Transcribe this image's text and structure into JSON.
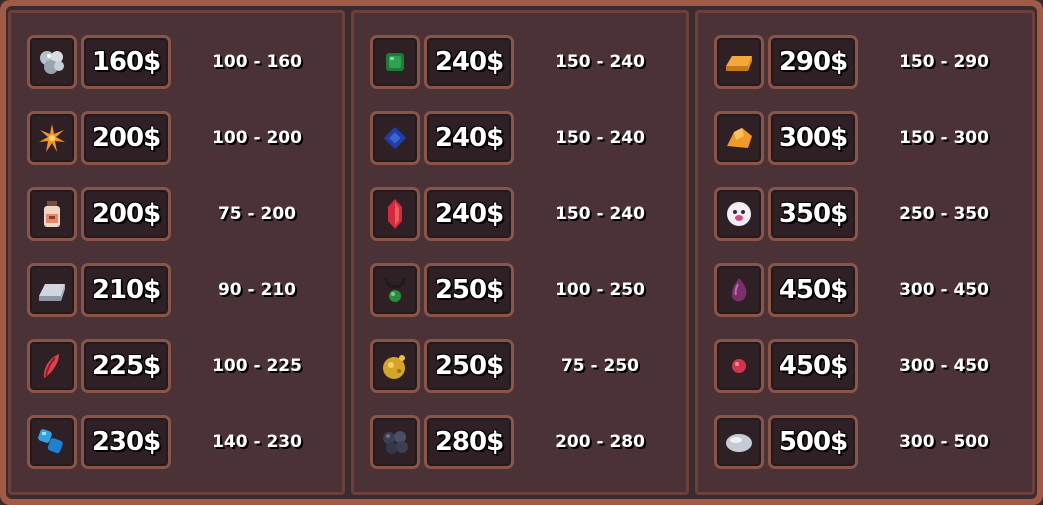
{
  "columns": [
    {
      "items": [
        {
          "icon": "silver-ore-icon",
          "price": "160$",
          "range": "100 - 160"
        },
        {
          "icon": "spark-icon",
          "price": "200$",
          "range": "100 - 200"
        },
        {
          "icon": "potion-jar-icon",
          "price": "200$",
          "range": "75 - 200"
        },
        {
          "icon": "iron-ingot-icon",
          "price": "210$",
          "range": "90 - 210"
        },
        {
          "icon": "red-feather-icon",
          "price": "225$",
          "range": "100 - 225"
        },
        {
          "icon": "blue-crystals-icon",
          "price": "230$",
          "range": "140 - 230"
        }
      ]
    },
    {
      "items": [
        {
          "icon": "emerald-icon",
          "price": "240$",
          "range": "150 - 240"
        },
        {
          "icon": "sapphire-icon",
          "price": "240$",
          "range": "150 - 240"
        },
        {
          "icon": "ruby-icon",
          "price": "240$",
          "range": "150 - 240"
        },
        {
          "icon": "green-amulet-icon",
          "price": "250$",
          "range": "100 - 250"
        },
        {
          "icon": "gold-nugget-icon",
          "price": "250$",
          "range": "75 - 250"
        },
        {
          "icon": "coal-ore-icon",
          "price": "280$",
          "range": "200 - 280"
        }
      ]
    },
    {
      "items": [
        {
          "icon": "gold-ingot-icon",
          "price": "290$",
          "range": "150 - 290"
        },
        {
          "icon": "amber-chunk-icon",
          "price": "300$",
          "range": "150 - 300"
        },
        {
          "icon": "ghost-icon",
          "price": "350$",
          "range": "250 - 350"
        },
        {
          "icon": "purple-gem-icon",
          "price": "450$",
          "range": "300 - 450"
        },
        {
          "icon": "red-orb-icon",
          "price": "450$",
          "range": "300 - 450"
        },
        {
          "icon": "moonstone-icon",
          "price": "500$",
          "range": "300 - 500"
        }
      ]
    }
  ]
}
